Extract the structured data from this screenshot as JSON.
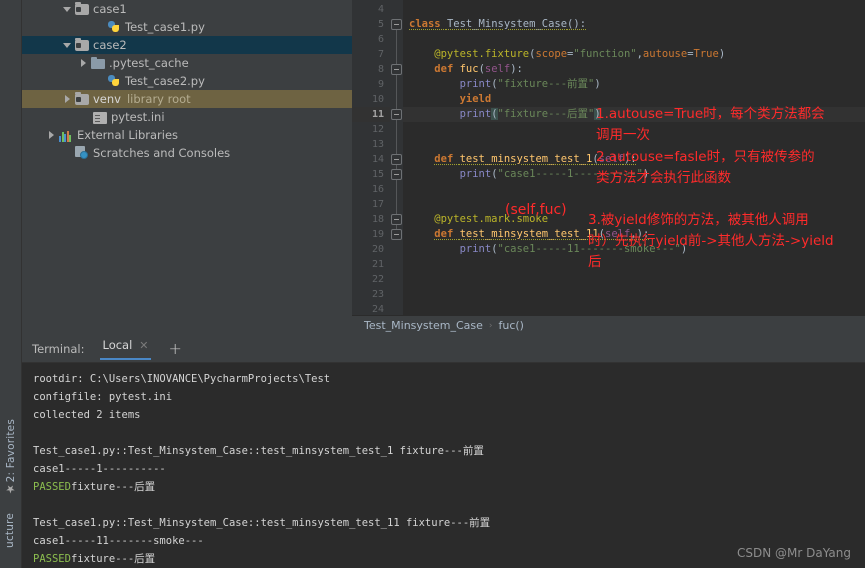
{
  "project_tree": {
    "items": [
      {
        "indent": 2,
        "arrow": "down",
        "icon": "folder-icon",
        "label": "case1",
        "hint": "",
        "state": "normal"
      },
      {
        "indent": 4,
        "arrow": "none",
        "icon": "python-file-icon",
        "label": "Test_case1.py",
        "hint": "",
        "state": "normal"
      },
      {
        "indent": 2,
        "arrow": "down",
        "icon": "folder-icon",
        "label": "case2",
        "hint": "",
        "state": "selected"
      },
      {
        "indent": 3,
        "arrow": "right",
        "icon": "folder-plain-icon",
        "label": ".pytest_cache",
        "hint": "",
        "state": "normal"
      },
      {
        "indent": 4,
        "arrow": "none",
        "icon": "python-file-icon",
        "label": "Test_case2.py",
        "hint": "",
        "state": "normal"
      },
      {
        "indent": 2,
        "arrow": "right",
        "icon": "folder-icon",
        "label": "venv",
        "hint": "library root",
        "state": "libroot"
      },
      {
        "indent": 3,
        "arrow": "none",
        "icon": "ini-file-icon",
        "label": "pytest.ini",
        "hint": "",
        "state": "normal"
      },
      {
        "indent": 1,
        "arrow": "right",
        "icon": "external-libraries-icon",
        "label": "External Libraries",
        "hint": "",
        "state": "normal"
      },
      {
        "indent": 2,
        "arrow": "none",
        "icon": "scratches-icon",
        "label": "Scratches and Consoles",
        "hint": "",
        "state": "normal"
      }
    ]
  },
  "editor": {
    "first_line_number": 4,
    "line_count": 21,
    "current_line": 11,
    "breadcrumb": {
      "class_name": "Test_Minsystem_Case",
      "separator": "›",
      "method_name": "fuc()"
    },
    "code_lines": [
      {
        "n": 4,
        "segments": []
      },
      {
        "n": 5,
        "segments": [
          {
            "t": "class ",
            "c": "tok-kw-b u-warn"
          },
          {
            "t": "Test_Minsystem_Case",
            "c": "tok-cls u-warn"
          },
          {
            "t": "():",
            "c": "tok-plain u-warn"
          }
        ]
      },
      {
        "n": 6,
        "segments": []
      },
      {
        "n": 7,
        "segments": [
          {
            "t": "    @pytest.fixture",
            "c": "tok-deco"
          },
          {
            "t": "(",
            "c": "tok-plain"
          },
          {
            "t": "scope",
            "c": "tok-kw"
          },
          {
            "t": "=",
            "c": "tok-plain"
          },
          {
            "t": "\"function\"",
            "c": "tok-str"
          },
          {
            "t": ",",
            "c": "tok-plain"
          },
          {
            "t": "autouse",
            "c": "tok-kw"
          },
          {
            "t": "=",
            "c": "tok-plain"
          },
          {
            "t": "True",
            "c": "tok-kw"
          },
          {
            "t": ")",
            "c": "tok-plain"
          }
        ]
      },
      {
        "n": 8,
        "segments": [
          {
            "t": "    ",
            "c": "tok-plain"
          },
          {
            "t": "def ",
            "c": "tok-kw-b"
          },
          {
            "t": "fuc",
            "c": "tok-def"
          },
          {
            "t": "(",
            "c": "tok-plain"
          },
          {
            "t": "self",
            "c": "tok-param"
          },
          {
            "t": "):",
            "c": "tok-plain"
          }
        ]
      },
      {
        "n": 9,
        "segments": [
          {
            "t": "        ",
            "c": "tok-plain"
          },
          {
            "t": "print",
            "c": "tok-print"
          },
          {
            "t": "(",
            "c": "tok-plain"
          },
          {
            "t": "\"fixture---前置\"",
            "c": "tok-str"
          },
          {
            "t": ")",
            "c": "tok-plain"
          }
        ]
      },
      {
        "n": 10,
        "segments": [
          {
            "t": "        ",
            "c": "tok-plain"
          },
          {
            "t": "yield",
            "c": "tok-kw-b"
          }
        ]
      },
      {
        "n": 11,
        "segments": [
          {
            "t": "        ",
            "c": "tok-plain"
          },
          {
            "t": "print",
            "c": "tok-print"
          },
          {
            "t": "(",
            "c": "tok-plain tok-hl"
          },
          {
            "t": "\"fixture---后置\"",
            "c": "tok-str"
          },
          {
            "t": ")",
            "c": "tok-plain tok-hl"
          }
        ]
      },
      {
        "n": 12,
        "segments": []
      },
      {
        "n": 13,
        "segments": []
      },
      {
        "n": 14,
        "segments": [
          {
            "t": "    ",
            "c": "tok-plain"
          },
          {
            "t": "def ",
            "c": "tok-kw-b u-warn"
          },
          {
            "t": "test_minsystem_test_1",
            "c": "tok-def u-warn"
          },
          {
            "t": "(",
            "c": "tok-plain u-warn"
          },
          {
            "t": "self",
            "c": "tok-param u-warn"
          },
          {
            "t": "):",
            "c": "tok-plain u-warn"
          }
        ]
      },
      {
        "n": 15,
        "segments": [
          {
            "t": "        ",
            "c": "tok-plain"
          },
          {
            "t": "print",
            "c": "tok-print"
          },
          {
            "t": "(",
            "c": "tok-plain"
          },
          {
            "t": "\"case1-----1----------\"",
            "c": "tok-str"
          },
          {
            "t": ")",
            "c": "tok-plain"
          }
        ]
      },
      {
        "n": 16,
        "segments": []
      },
      {
        "n": 17,
        "segments": []
      },
      {
        "n": 18,
        "segments": [
          {
            "t": "    @pytest.mark.smoke",
            "c": "tok-deco"
          }
        ]
      },
      {
        "n": 19,
        "segments": [
          {
            "t": "    ",
            "c": "tok-plain"
          },
          {
            "t": "def ",
            "c": "tok-kw-b u-warn"
          },
          {
            "t": "test_minsystem_test_11",
            "c": "tok-def u-warn"
          },
          {
            "t": "(",
            "c": "tok-plain u-warn"
          },
          {
            "t": "self",
            "c": "tok-param u-warn"
          },
          {
            "t": ",):",
            "c": "tok-plain u-warn"
          }
        ]
      },
      {
        "n": 20,
        "segments": [
          {
            "t": "        ",
            "c": "tok-plain"
          },
          {
            "t": "print",
            "c": "tok-print"
          },
          {
            "t": "(",
            "c": "tok-plain"
          },
          {
            "t": "\"case1-----11-------smoke---\"",
            "c": "tok-str"
          },
          {
            "t": ")",
            "c": "tok-plain"
          }
        ]
      },
      {
        "n": 21,
        "segments": []
      },
      {
        "n": 22,
        "segments": []
      },
      {
        "n": 23,
        "segments": []
      },
      {
        "n": 24,
        "segments": []
      }
    ]
  },
  "annotations": {
    "handwritten_self_fuc": "(self,fuc)",
    "note_1": "1.autouse=True时，每个类方法都会\n调用一次",
    "note_2": "2.autouse=fasle时，只有被传参的\n类方法才会执行此函数",
    "note_3": "3.被yield修饰的方法，被其他人调用\n时）先执行yield前->其他人方法->yield\n后",
    "color": "#ff2b2b"
  },
  "terminal": {
    "title": "Terminal:",
    "active_tab": "Local",
    "close_label": "✕",
    "add_label": "+",
    "output": [
      {
        "text": "rootdir: C:\\Users\\INOVANCE\\PycharmProjects\\Test",
        "kind": "plain"
      },
      {
        "text": "configfile: pytest.ini",
        "kind": "plain"
      },
      {
        "text": "collected 2 items",
        "kind": "plain"
      },
      {
        "text": "",
        "kind": "plain"
      },
      {
        "text": "Test_case1.py::Test_Minsystem_Case::test_minsystem_test_1 fixture---前置",
        "kind": "plain"
      },
      {
        "text": "case1-----1----------",
        "kind": "plain"
      },
      {
        "text": "PASSED",
        "suffix": "fixture---后置",
        "kind": "passed"
      },
      {
        "text": "",
        "kind": "plain"
      },
      {
        "text": "Test_case1.py::Test_Minsystem_Case::test_minsystem_test_11 fixture---前置",
        "kind": "plain"
      },
      {
        "text": "case1-----11-------smoke---",
        "kind": "plain"
      },
      {
        "text": "PASSED",
        "suffix": "fixture---后置",
        "kind": "passed"
      }
    ]
  },
  "tool_strip": {
    "favorites_label": "2: Favorites",
    "star": "★",
    "structure_label": "ucture"
  },
  "watermark": "CSDN @Mr DaYang"
}
